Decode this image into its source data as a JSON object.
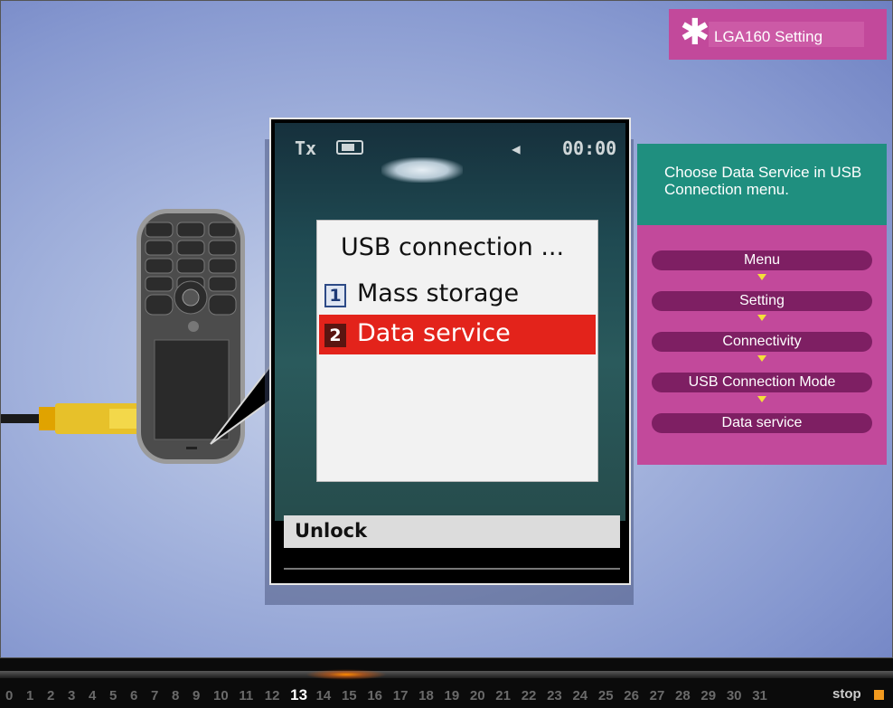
{
  "title_badge": {
    "icon": "asterisk-icon",
    "text": "LGA160 Setting"
  },
  "phone_screen": {
    "status": {
      "signal": "Tx",
      "time": "00:00"
    },
    "menu_title": "USB connection ...",
    "items": [
      {
        "number": "1",
        "label": "Mass storage",
        "selected": false
      },
      {
        "number": "2",
        "label": "Data service",
        "selected": true
      }
    ],
    "softkey": "Unlock"
  },
  "instruction": "Choose Data Service in USB Connection menu.",
  "path_steps": [
    "Menu",
    "Setting",
    "Connectivity",
    "USB Connection Mode",
    "Data service"
  ],
  "timeline": {
    "frames": [
      "0",
      "1",
      "2",
      "3",
      "4",
      "5",
      "6",
      "7",
      "8",
      "9",
      "10",
      "11",
      "12",
      "13",
      "14",
      "15",
      "16",
      "17",
      "18",
      "19",
      "20",
      "21",
      "22",
      "23",
      "24",
      "25",
      "26",
      "27",
      "28",
      "29",
      "30",
      "31"
    ],
    "current": "13",
    "stop_label": "stop"
  },
  "colors": {
    "magenta": "#c2499b",
    "teal": "#1f8f7f",
    "step_pill": "#7e1f63",
    "highlight_red": "#e3231b",
    "accent_orange": "#f29a1f"
  }
}
